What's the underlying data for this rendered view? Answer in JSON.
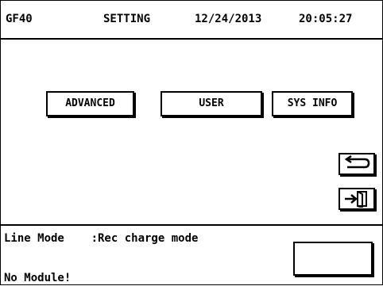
{
  "header": {
    "model": "GF40",
    "title": "SETTING",
    "date": "12/24/2013",
    "time": "20:05:27"
  },
  "menu": {
    "advanced_label": "ADVANCED",
    "user_label": "USER",
    "sysinfo_label": "SYS INFO"
  },
  "icons": {
    "back": "back-arrow-icon",
    "exit": "exit-door-icon"
  },
  "footer": {
    "mode_label": "Line Mode",
    "mode_value": ":Rec charge mode",
    "module_status": "No Module!"
  }
}
